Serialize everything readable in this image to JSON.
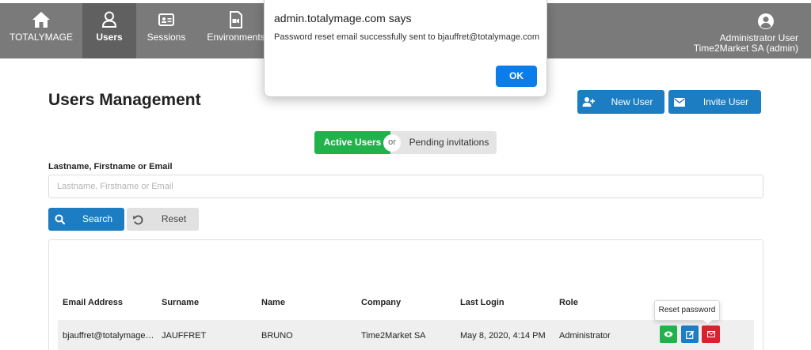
{
  "nav": {
    "brand_label": "TOTALYMAGE",
    "items": [
      {
        "label": "Users",
        "icon": "user-icon"
      },
      {
        "label": "Sessions",
        "icon": "id-card-icon"
      },
      {
        "label": "Environments",
        "icon": "file-video-icon"
      }
    ],
    "user": {
      "name": "Administrator User",
      "org": "Time2Market SA (admin)",
      "icon": "user-circle-icon"
    }
  },
  "dialog": {
    "title": "admin.totalymage.com says",
    "message": "Password reset email successfully sent to bjauffret@totalymage.com",
    "ok_label": "OK"
  },
  "header": {
    "title": "Users Management",
    "new_user_label": "New User",
    "invite_user_label": "Invite User"
  },
  "toggle": {
    "active_label": "Active Users",
    "or_label": "or",
    "pending_label": "Pending invitations"
  },
  "search": {
    "label": "Lastname, Firstname or Email",
    "placeholder": "Lastname, Firstname or Email",
    "value": "",
    "search_label": "Search",
    "reset_label": "Reset"
  },
  "table": {
    "columns": [
      "Email Address",
      "Surname",
      "Name",
      "Company",
      "Last Login",
      "Role"
    ],
    "rows": [
      {
        "email": "bjauffret@totalymage…",
        "surname": "JAUFFRET",
        "name": "BRUNO",
        "company": "Time2Market SA",
        "last_login": "May 8, 2020, 4:14 PM",
        "role": "Administrator"
      }
    ],
    "tooltip": "Reset password"
  },
  "colors": {
    "navbar": "#7a7a7a",
    "primary": "#1d7dc2",
    "success": "#22b24c",
    "danger": "#d9232c",
    "dialog_ok": "#0b7dea"
  }
}
